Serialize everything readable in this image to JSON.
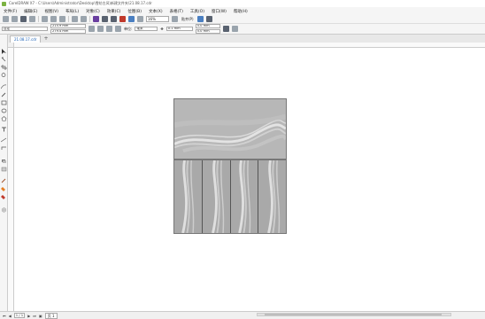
{
  "window": {
    "title": "CorelDRAW X7 - C:\\Users\\Administrator\\Desktop\\雪纺古风\\新建文件夹\\21.08.17.cdr"
  },
  "menu": [
    "文件(F)",
    "编辑(E)",
    "视图(V)",
    "布局(L)",
    "对象(C)",
    "效果(C)",
    "位图(B)",
    "文本(X)",
    "表格(T)",
    "工具(O)",
    "窗口(W)",
    "帮助(H)"
  ],
  "standard_toolbar": {
    "zoom_value": "16%",
    "snap_label": "贴齐(P)",
    "icons": [
      "new-icon",
      "open-icon",
      "save-icon",
      "print-icon",
      "cut-icon",
      "copy-icon",
      "paste-icon",
      "undo-icon",
      "redo-icon",
      "search-content-icon",
      "import-icon",
      "export-icon",
      "publish-pdf-icon",
      "corel-connect-icon",
      "application-launcher-icon",
      "zoom-select",
      "full-screen-icon",
      "snap-to-select",
      "options-icon",
      "launcher-icon"
    ]
  },
  "property_bar": {
    "paper_size": "自定",
    "width": "215.9 mm",
    "height": "279.4 mm",
    "units_label": "单位:",
    "units_value": "毫米",
    "nudge": "0.1 mm",
    "dup_x": "5.0 mm",
    "dup_y": "5.0 mm"
  },
  "document_tab": {
    "name": "21.08.17.cdr",
    "add_label": "+"
  },
  "status_bar": {
    "page_counter": "1 / 1",
    "page_tab": "页 1"
  },
  "colors": {
    "canvas": "#ffffff",
    "workspace": "#f0f0f0",
    "design_panel": "#b9b9b9",
    "tab_text": "#1a5fb4"
  }
}
